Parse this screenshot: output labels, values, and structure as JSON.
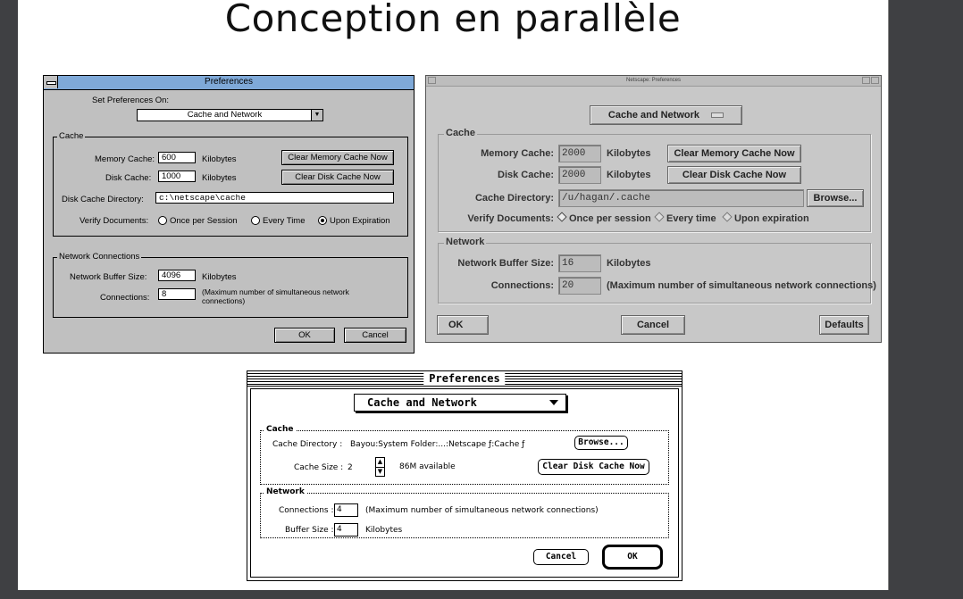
{
  "slide": {
    "title": "Conception en parallèle"
  },
  "windows_dialog": {
    "title": "Preferences",
    "set_prefs_label": "Set Preferences On:",
    "category": "Cache and Network",
    "cache_group": "Cache",
    "memory_cache_label": "Memory Cache:",
    "memory_cache_value": "600",
    "memory_unit": "Kilobytes",
    "clear_memory_button": "Clear Memory Cache Now",
    "disk_cache_label": "Disk Cache:",
    "disk_cache_value": "1000",
    "disk_unit": "Kilobytes",
    "clear_disk_button": "Clear Disk Cache Now",
    "dir_label": "Disk Cache Directory:",
    "dir_value": "c:\\netscape\\cache",
    "verify_label": "Verify Documents:",
    "verify_options": [
      "Once per Session",
      "Every Time",
      "Upon Expiration"
    ],
    "network_group": "Network Connections",
    "buffer_label": "Network Buffer Size:",
    "buffer_value": "4096",
    "buffer_unit": "Kilobytes",
    "connections_label": "Connections:",
    "connections_value": "8",
    "connections_note": "(Maximum number of simultaneous network connections)",
    "ok_button": "OK",
    "cancel_button": "Cancel"
  },
  "motif_dialog": {
    "title": "Netscape: Preferences",
    "category": "Cache and Network",
    "cache_group": "Cache",
    "memory_cache_label": "Memory Cache:",
    "memory_cache_value": "2000",
    "memory_unit": "Kilobytes",
    "clear_memory_button": "Clear Memory Cache Now",
    "disk_cache_label": "Disk Cache:",
    "disk_cache_value": "2000",
    "disk_unit": "Kilobytes",
    "clear_disk_button": "Clear Disk Cache Now",
    "dir_label": "Cache Directory:",
    "dir_value": "/u/hagan/.cache",
    "browse_button": "Browse...",
    "verify_label": "Verify Documents:",
    "verify_options": [
      "Once per session",
      "Every time",
      "Upon expiration"
    ],
    "network_group": "Network",
    "buffer_label": "Network Buffer Size:",
    "buffer_value": "16",
    "buffer_unit": "Kilobytes",
    "connections_label": "Connections:",
    "connections_value": "20",
    "connections_note": "(Maximum number of simultaneous network connections)",
    "ok_button": "OK",
    "cancel_button": "Cancel",
    "defaults_button": "Defaults"
  },
  "mac_dialog": {
    "title": "Preferences",
    "category": "Cache and Network",
    "cache_group": "Cache",
    "dir_label": "Cache Directory :",
    "dir_value": "Bayou:System Folder:...:Netscape ƒ:Cache ƒ",
    "browse_button": "Browse...",
    "cache_size_label": "Cache Size :",
    "cache_size_value": "2",
    "available_text": "86M available",
    "clear_disk_button": "Clear Disk Cache Now",
    "network_group": "Network",
    "connections_label": "Connections :",
    "connections_value": "4",
    "connections_note": "(Maximum number of simultaneous network connections)",
    "buffer_label": "Buffer Size :",
    "buffer_value": "4",
    "buffer_unit": "Kilobytes",
    "cancel_button": "Cancel",
    "ok_button": "OK"
  }
}
